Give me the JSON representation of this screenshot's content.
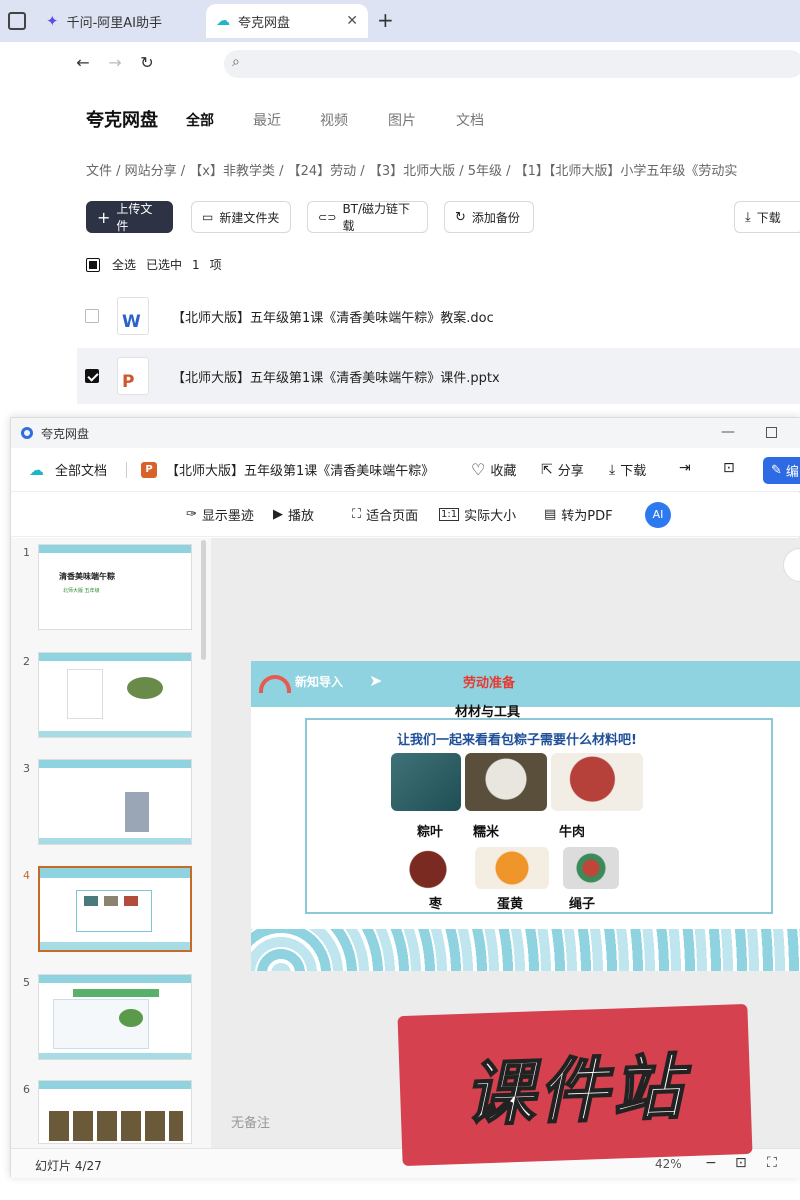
{
  "tabs": [
    {
      "label": "千问-阿里AI助手"
    },
    {
      "label": "夸克网盘",
      "active": true
    }
  ],
  "icons": {
    "back": "arrow-left-icon",
    "forward": "arrow-right-icon",
    "reload": "reload-icon",
    "search": "search-icon",
    "plus": "plus-icon",
    "close": "close-icon"
  },
  "page": {
    "brand": "夸克网盘",
    "nav_tabs": [
      "全部",
      "最近",
      "视频",
      "图片",
      "文档"
    ],
    "breadcrumb": "文件 / 网站分享 / 【x】非教学类 / 【24】劳动 / 【3】北师大版 / 5年级 / 【1】【北师大版】小学五年级《劳动实",
    "toolbar": {
      "upload": "上传文件",
      "new_folder": "新建文件夹",
      "bt": "BT/磁力链下载",
      "backup": "添加备份",
      "download": "下载"
    },
    "selection": {
      "select_all": "全选",
      "selected_prefix": "已选中",
      "count": "1",
      "unit": "项"
    },
    "files": [
      {
        "name": "【北师大版】五年级第1课《清香美味端午粽》教案.doc",
        "type": "doc",
        "checked": false
      },
      {
        "name": "【北师大版】五年级第1课《清香美味端午粽》课件.pptx",
        "type": "pptx",
        "checked": true
      }
    ]
  },
  "viewer": {
    "window_title": "夸克网盘",
    "all_docs": "全部文档",
    "doc_title": "【北师大版】五年级第1课《清香美味端午粽》",
    "actions": {
      "favorite": "收藏",
      "share": "分享",
      "download": "下载",
      "edit": "编"
    },
    "tools": [
      "显示墨迹",
      "播放",
      "适合页面",
      "实际大小",
      "转为PDF"
    ],
    "thumbnails": [
      {
        "num": "1",
        "title": "清香美味端午粽",
        "sub": "北师大版  五年级"
      },
      {
        "num": "2"
      },
      {
        "num": "3"
      },
      {
        "num": "4"
      },
      {
        "num": "5"
      },
      {
        "num": "6"
      }
    ],
    "current_slide": 4,
    "no_notes": "无备注",
    "slide_counter": "幻灯片 4/27",
    "zoom": "42%",
    "slide": {
      "banner_left": "新知导入",
      "banner_center": "劳动准备",
      "heading": "材材与工具",
      "question": "让我们一起来看看包粽子需要什么材料吧!",
      "items": [
        "粽叶",
        "糯米",
        "牛肉",
        "枣",
        "蛋黄",
        "绳子"
      ]
    }
  },
  "watermark_text": "课件站"
}
